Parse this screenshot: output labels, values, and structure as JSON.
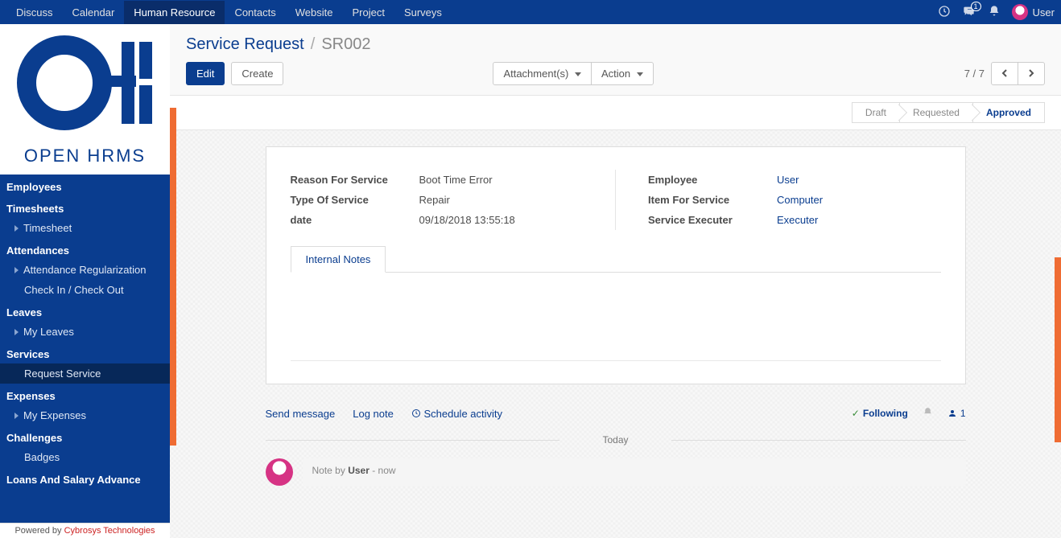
{
  "topnav": {
    "items": [
      "Discuss",
      "Calendar",
      "Human Resource",
      "Contacts",
      "Website",
      "Project",
      "Surveys"
    ],
    "active_index": 2,
    "messages_badge": "1",
    "user_name": "User"
  },
  "logo_text": "OPEN HRMS",
  "sidebar": [
    {
      "header": "Employees",
      "items": []
    },
    {
      "header": "Timesheets",
      "items": [
        {
          "label": "Timesheet",
          "caret": true
        }
      ]
    },
    {
      "header": "Attendances",
      "items": [
        {
          "label": "Attendance Regularization",
          "caret": true
        },
        {
          "label": "Check In / Check Out",
          "caret": false
        }
      ]
    },
    {
      "header": "Leaves",
      "items": [
        {
          "label": "My Leaves",
          "caret": true
        }
      ]
    },
    {
      "header": "Services",
      "items": [
        {
          "label": "Request Service",
          "caret": false,
          "active": true
        }
      ]
    },
    {
      "header": "Expenses",
      "items": [
        {
          "label": "My Expenses",
          "caret": true
        }
      ]
    },
    {
      "header": "Challenges",
      "items": [
        {
          "label": "Badges",
          "caret": false
        }
      ]
    },
    {
      "header": "Loans And Salary Advance",
      "items": []
    }
  ],
  "powered": {
    "prefix": "Powered by ",
    "brand": "Cybrosys Technologies"
  },
  "breadcrumb": {
    "root": "Service Request",
    "sep": "/",
    "leaf": "SR002"
  },
  "controls": {
    "edit": "Edit",
    "create": "Create",
    "attachments": "Attachment(s)",
    "action": "Action",
    "pager": "7 / 7"
  },
  "status": {
    "steps": [
      "Draft",
      "Requested",
      "Approved"
    ],
    "active_index": 2
  },
  "form": {
    "left": [
      {
        "label": "Reason For Service",
        "value": "Boot Time Error"
      },
      {
        "label": "Type Of Service",
        "value": "Repair"
      },
      {
        "label": "date",
        "value": "09/18/2018 13:55:18"
      }
    ],
    "right": [
      {
        "label": "Employee",
        "value": "User",
        "link": true
      },
      {
        "label": "Item For Service",
        "value": "Computer",
        "link": true
      },
      {
        "label": "Service Executer",
        "value": "Executer",
        "link": true
      }
    ],
    "tab": "Internal Notes"
  },
  "chatter": {
    "send": "Send message",
    "log": "Log note",
    "schedule": "Schedule activity",
    "following": "Following",
    "follower_count": "1",
    "day": "Today",
    "note_prefix": "Note by ",
    "note_user": "User",
    "note_suffix": " - now"
  }
}
